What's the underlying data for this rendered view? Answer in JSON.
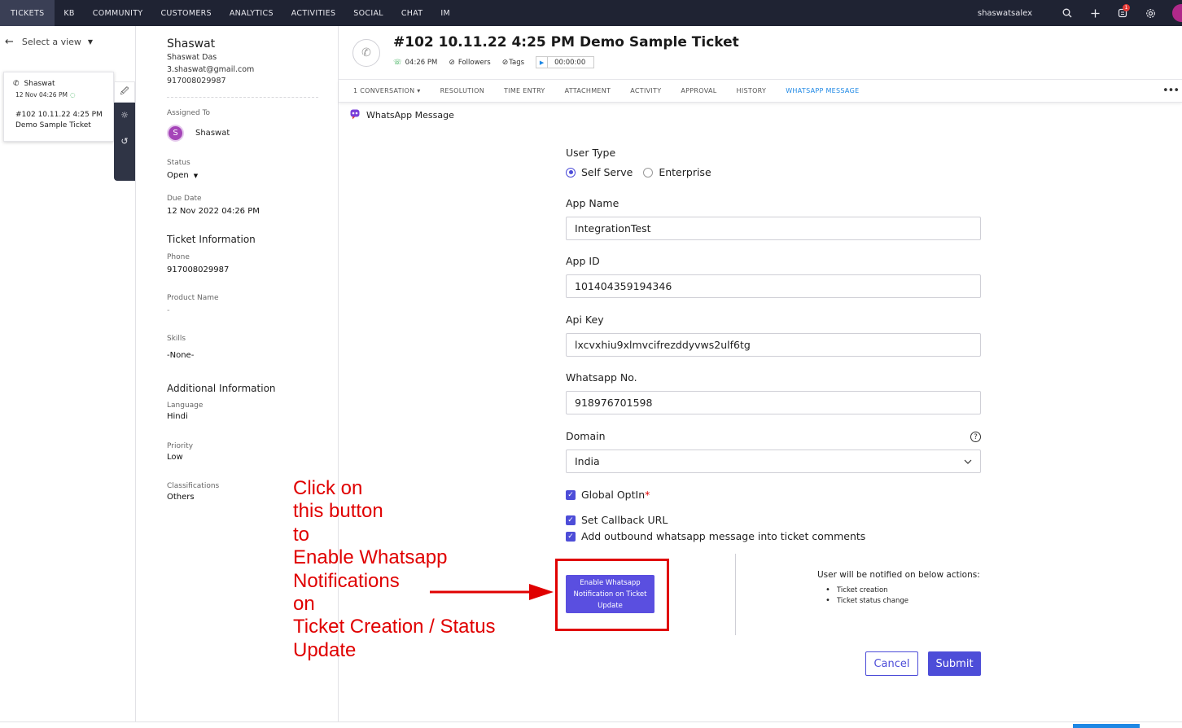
{
  "topnav": {
    "tabs": [
      "TICKETS",
      "KB",
      "COMMUNITY",
      "CUSTOMERS",
      "ANALYTICS",
      "ACTIVITIES",
      "SOCIAL",
      "CHAT",
      "IM"
    ],
    "user": "shaswatsalex",
    "notification_count": "1"
  },
  "list": {
    "select_view": "Select a view",
    "card": {
      "contact": "Shaswat",
      "time": "12 Nov 04:26 PM",
      "subject": "#102   10.11.22 4:25 PM Demo Sample Ticket"
    }
  },
  "details": {
    "name": "Shaswat",
    "full_name": "Shaswat Das",
    "email": "3.shaswat@gmail.com",
    "phone_top": "917008029987",
    "assigned_label": "Assigned To",
    "assignee_initial": "S",
    "assignee": "Shaswat",
    "status_label": "Status",
    "status": "Open",
    "due_label": "Due Date",
    "due": "12 Nov 2022 04:26 PM",
    "ticket_info": "Ticket Information",
    "phone_label": "Phone",
    "phone": "917008029987",
    "product_label": "Product Name",
    "product": "-",
    "skills_label": "Skills",
    "skills": "-None-",
    "additional": "Additional Information",
    "language_label": "Language",
    "language": "Hindi",
    "priority_label": "Priority",
    "priority": "Low",
    "class_label": "Classifications",
    "classification": "Others"
  },
  "annotation": {
    "text": "Click on\nthis button\nto\nEnable Whatsapp\nNotifications\non\nTicket Creation / Status\nUpdate",
    "color": "#e00000"
  },
  "ticket": {
    "title": "#102  10.11.22 4:25 PM Demo Sample Ticket",
    "time": "04:26 PM",
    "followers": "Followers",
    "tags": "Tags",
    "timer": "00:00:00"
  },
  "subtabs": [
    {
      "label": "1  CONVERSATION  ▾",
      "active": false
    },
    {
      "label": "RESOLUTION",
      "active": false
    },
    {
      "label": "TIME ENTRY",
      "active": false
    },
    {
      "label": "ATTACHMENT",
      "active": false
    },
    {
      "label": "ACTIVITY",
      "active": false
    },
    {
      "label": "APPROVAL",
      "active": false
    },
    {
      "label": "HISTORY",
      "active": false
    },
    {
      "label": "WHATSAPP MESSAGE",
      "active": true
    }
  ],
  "form": {
    "section_title": "WhatsApp Message",
    "user_type_label": "User Type",
    "user_type_options": [
      "Self Serve",
      "Enterprise"
    ],
    "user_type_selected": "Self Serve",
    "app_name_label": "App Name",
    "app_name": "IntegrationTest",
    "app_id_label": "App ID",
    "app_id": "101404359194346",
    "api_key_label": "Api Key",
    "api_key": "lxcvxhiu9xlmvcifrezddyvws2ulf6tg",
    "whatsapp_label": "Whatsapp No.",
    "whatsapp": "918976701598",
    "domain_label": "Domain",
    "domain": "India",
    "global_optin": "Global OptIn",
    "required_mark": "*",
    "callback": "Set Callback URL",
    "outbound": "Add outbound whatsapp message into ticket comments",
    "enable_button": "Enable Whatsapp Notification on Ticket Update",
    "notify_title": "User will be notified on below actions:",
    "notify_items": [
      "Ticket creation",
      "Ticket status change"
    ],
    "cancel": "Cancel",
    "submit": "Submit"
  },
  "colors": {
    "nav_bg": "#1f2333",
    "accent": "#4d4dd8",
    "active_tab": "#1e88e5",
    "annotation_red": "#e00000"
  }
}
